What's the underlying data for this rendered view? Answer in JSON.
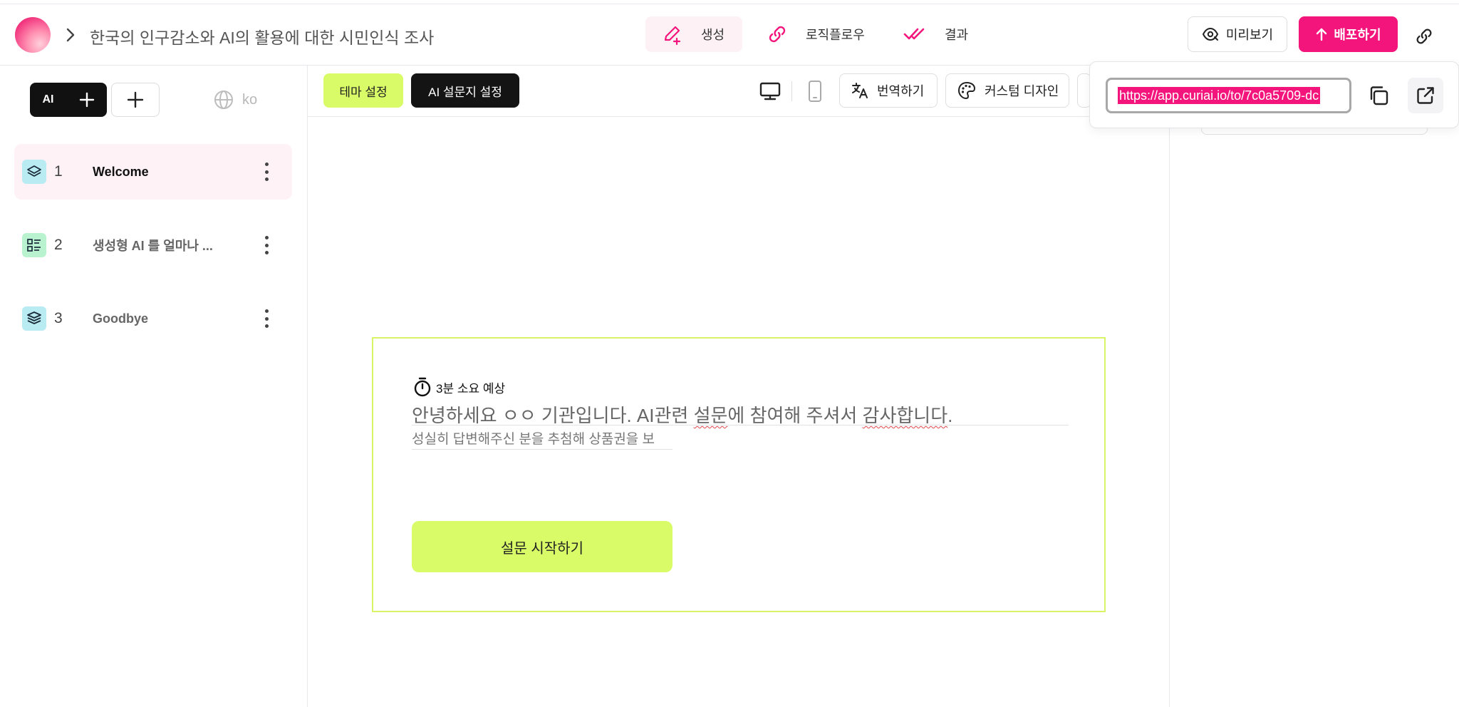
{
  "header": {
    "doc_title": "한국의 인구감소와 AI의 활용에 대한 시민인식 조사",
    "nav": [
      {
        "label": "생성",
        "icon": "pen-plus-icon",
        "active": true
      },
      {
        "label": "로직플로우",
        "icon": "link-icon",
        "active": false
      },
      {
        "label": "결과",
        "icon": "double-check-icon",
        "active": false
      }
    ],
    "preview_label": "미리보기",
    "deploy_label": "배포하기",
    "accent_color": "#f4157c"
  },
  "sidebar": {
    "ai_label": "AI",
    "language": "ko",
    "pages": [
      {
        "num": "1",
        "name": "Welcome",
        "icon": "layers-icon"
      },
      {
        "num": "2",
        "name": "생성형 AI 를 얼마나 ...",
        "icon": "list-icon"
      },
      {
        "num": "3",
        "name": "Goodbye",
        "icon": "layers-icon"
      }
    ]
  },
  "toolbar": {
    "theme_label": "테마 설정",
    "ai_survey_label": "AI 설문지 설정",
    "translate_label": "번역하기",
    "custom_design_label": "커스텀 디자인"
  },
  "welcome": {
    "time_estimate": "3분 소요 예상",
    "headline_parts": [
      "안녕하세요 ㅇㅇ 기관입니다. AI관련 ",
      "설문",
      "에 참여해 주셔서 ",
      "감사합니다",
      "."
    ],
    "subline": "성실히 답변해주신 분을 추첨해 상품권을 보",
    "start_label": "설문 시작하기",
    "lime_color": "#d8fb67"
  },
  "share_popover": {
    "url": "https://app.curiai.io/to/7c0a5709-dc"
  }
}
